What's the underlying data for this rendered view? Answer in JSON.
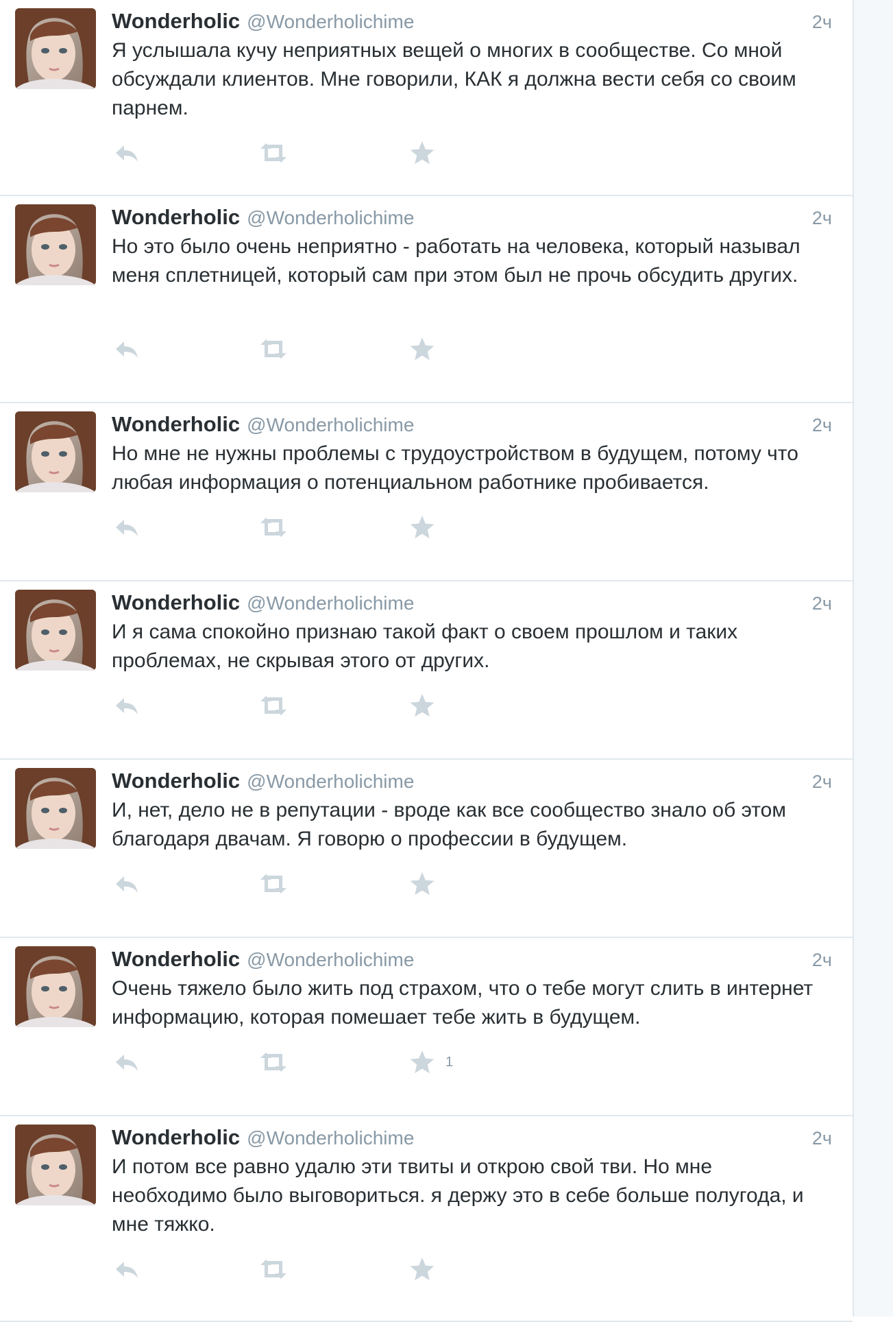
{
  "tweets": [
    {
      "name": "Wonderholic",
      "handle": "@Wonderholichime",
      "time": "2ч",
      "text": "Я услышала кучу неприятных вещей о многих в сообществе. Со мной обсуждали клиентов. Мне говорили, КАК я должна вести себя со своим парнем.",
      "favorites": ""
    },
    {
      "name": "Wonderholic",
      "handle": "@Wonderholichime",
      "time": "2ч",
      "text": "Но это было очень неприятно - работать на человека, который называл меня сплетницей, который сам при этом был не прочь обсудить других.",
      "favorites": ""
    },
    {
      "name": "Wonderholic",
      "handle": "@Wonderholichime",
      "time": "2ч",
      "text": "Но мне не нужны проблемы с трудоустройством в будущем, потому что любая информация о потенциальном работнике пробивается.",
      "favorites": ""
    },
    {
      "name": "Wonderholic",
      "handle": "@Wonderholichime",
      "time": "2ч",
      "text": "И я сама спокойно признаю такой факт о своем прошлом и таких проблемах, не скрывая этого от других.",
      "favorites": ""
    },
    {
      "name": "Wonderholic",
      "handle": "@Wonderholichime",
      "time": "2ч",
      "text": "И, нет, дело не в репутации - вроде как все сообщество знало об этом благодаря двачам. Я говорю о профессии в будущем.",
      "favorites": ""
    },
    {
      "name": "Wonderholic",
      "handle": "@Wonderholichime",
      "time": "2ч",
      "text": "Очень тяжело было жить под страхом, что о тебе могут слить в интернет информацию, которая помешает тебе жить в будущем.",
      "favorites": "1"
    },
    {
      "name": "Wonderholic",
      "handle": "@Wonderholichime",
      "time": "2ч",
      "text": "И потом все равно удалю эти твиты и открою свой тви. Но мне необходимо было выговориться. я держу это в себе больше полугода, и мне тяжко.",
      "favorites": ""
    }
  ],
  "icons": {
    "reply": "reply-icon",
    "retweet": "retweet-icon",
    "favorite": "star-icon"
  },
  "colors": {
    "text": "#292f33",
    "muted": "#8899a6",
    "action_icon": "#ccd6dd",
    "divider": "#e1e8ed"
  }
}
